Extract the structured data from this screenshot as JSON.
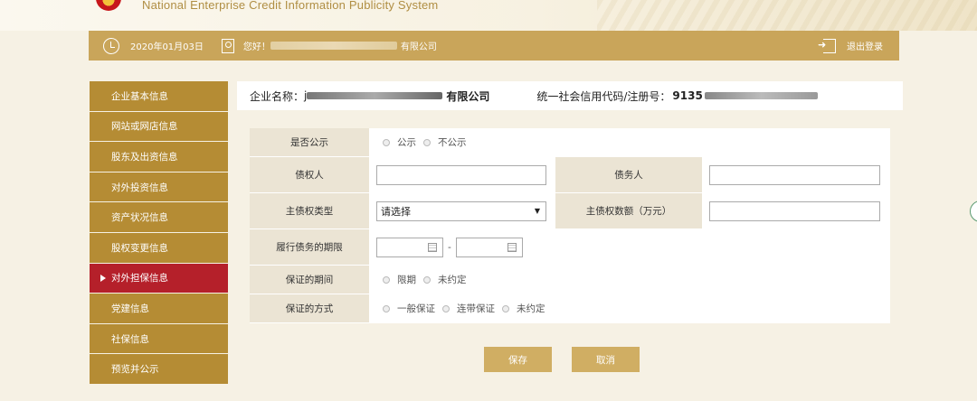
{
  "header": {
    "system_name": "National Enterprise Credit Information Publicity System"
  },
  "topbar": {
    "date": "2020年01月03日",
    "greeting": "您好！",
    "company_suffix": "有限公司",
    "logout": "退出登录"
  },
  "sidebar": {
    "items": [
      {
        "label": "企业基本信息"
      },
      {
        "label": "网站或网店信息"
      },
      {
        "label": "股东及出资信息"
      },
      {
        "label": "对外投资信息"
      },
      {
        "label": "资产状况信息"
      },
      {
        "label": "股权变更信息"
      },
      {
        "label": "对外担保信息",
        "active": true
      },
      {
        "label": "党建信息"
      },
      {
        "label": "社保信息"
      },
      {
        "label": "预览并公示"
      }
    ]
  },
  "company_info": {
    "name_label": "企业名称：",
    "name_prefix": "j",
    "name_suffix": "有限公司",
    "code_label": "统一社会信用代码/注册号：",
    "code_prefix": "9135"
  },
  "form": {
    "publicity": {
      "label": "是否公示",
      "options": [
        "公示",
        "不公示"
      ]
    },
    "creditor": {
      "label": "债权人",
      "value": ""
    },
    "debtor": {
      "label": "债务人",
      "value": ""
    },
    "claim_type": {
      "label": "主债权类型",
      "selected": "请选择"
    },
    "claim_amount": {
      "label": "主债权数额（万元）",
      "value": ""
    },
    "performance_period": {
      "label": "履行债务的期限",
      "separator": "-"
    },
    "guarantee_period": {
      "label": "保证的期间",
      "options": [
        "限期",
        "未约定"
      ]
    },
    "guarantee_method": {
      "label": "保证的方式",
      "options": [
        "一般保证",
        "连带保证",
        "未约定"
      ]
    }
  },
  "buttons": {
    "save": "保存",
    "cancel": "取消"
  }
}
